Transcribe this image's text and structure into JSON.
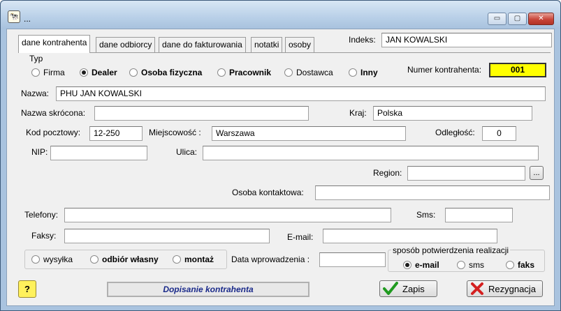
{
  "window": {
    "title": "...",
    "app_icon": "cow-icon",
    "buttons": {
      "minimize": "▭",
      "maximize": "▢",
      "close": "✕"
    }
  },
  "tabs": [
    "dane kontrahenta",
    "dane odbiorcy",
    "dane do fakturowania",
    "notatki",
    "osoby"
  ],
  "indeks": {
    "label": "Indeks:",
    "value": "JAN KOWALSKI"
  },
  "typ": {
    "label": "Typ",
    "options": [
      "Firma",
      "Dealer",
      "Osoba fizyczna",
      "Pracownik",
      "Dostawca",
      "Inny"
    ],
    "selected": "Dealer"
  },
  "numer": {
    "label": "Numer kontrahenta:",
    "value": "001"
  },
  "nazwa": {
    "label": "Nazwa:",
    "value": "PHU JAN KOWALSKI"
  },
  "nazwa_skrocona": {
    "label": "Nazwa skrócona:",
    "value": ""
  },
  "kraj": {
    "label": "Kraj:",
    "value": "Polska"
  },
  "kod": {
    "label": "Kod pocztowy:",
    "value": "12-250"
  },
  "miejscowosc": {
    "label": "Miejscowość :",
    "value": "Warszawa"
  },
  "odleglosc": {
    "label": "Odległość:",
    "value": "0"
  },
  "nip": {
    "label": "NIP:",
    "value": ""
  },
  "ulica": {
    "label": "Ulica:",
    "value": ""
  },
  "region": {
    "label": "Region:",
    "value": "",
    "button": "..."
  },
  "osoba": {
    "label": "Osoba kontaktowa:",
    "value": ""
  },
  "telefony": {
    "label": "Telefony:",
    "value": ""
  },
  "sms": {
    "label": "Sms:",
    "value": ""
  },
  "faksy": {
    "label": "Faksy:",
    "value": ""
  },
  "email": {
    "label": "E-mail:",
    "value": ""
  },
  "dostawa": {
    "options": [
      "wysyłka",
      "odbiór własny",
      "montaż"
    ]
  },
  "data_wprowadzenia": {
    "label": "Data wprowadzenia :",
    "value": ""
  },
  "potwierdzenie": {
    "label": "sposób potwierdzenia realizacji",
    "options": [
      "e-mail",
      "sms",
      "faks"
    ],
    "selected": "e-mail"
  },
  "footer": {
    "help": "?",
    "status": "Dopisanie kontrahenta",
    "save": "Zapis",
    "cancel": "Rezygnacja"
  }
}
